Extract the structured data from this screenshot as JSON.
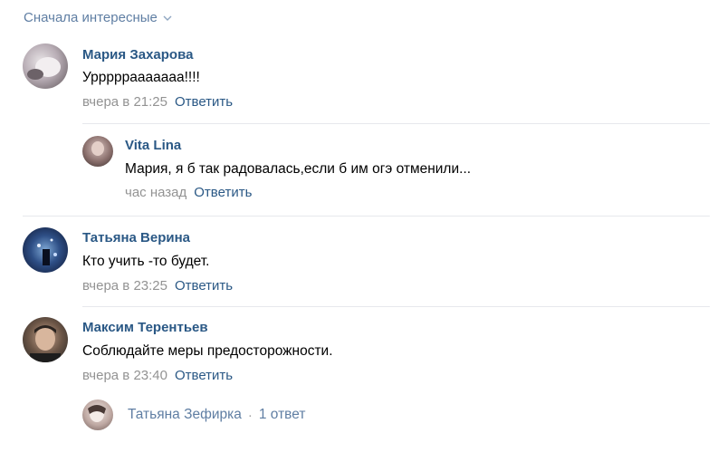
{
  "sort": {
    "label": "Сначала интересные"
  },
  "comments": [
    {
      "author": "Мария Захарова",
      "text": "Урррррааааааа!!!!",
      "time": "вчера в 21:25",
      "reply_label": "Ответить"
    },
    {
      "author": "Vita Lina",
      "text": "Мария, я б так радовалась,если б им огэ отменили...",
      "time": "час назад",
      "reply_label": "Ответить"
    },
    {
      "author": "Татьяна Верина",
      "text": "Кто учить -то будет.",
      "time": "вчера в 23:25",
      "reply_label": "Ответить"
    },
    {
      "author": "Максим Терентьев",
      "text": "Соблюдайте меры предосторожности.",
      "time": "вчера в 23:40",
      "reply_label": "Ответить"
    }
  ],
  "more_replies": {
    "author": "Татьяна Зефирка",
    "separator": "·",
    "count_label": "1 ответ"
  },
  "colors": {
    "link": "#2a5885",
    "meta": "#939393",
    "sort": "#5f7ea3",
    "divider": "#e7e8ec"
  }
}
